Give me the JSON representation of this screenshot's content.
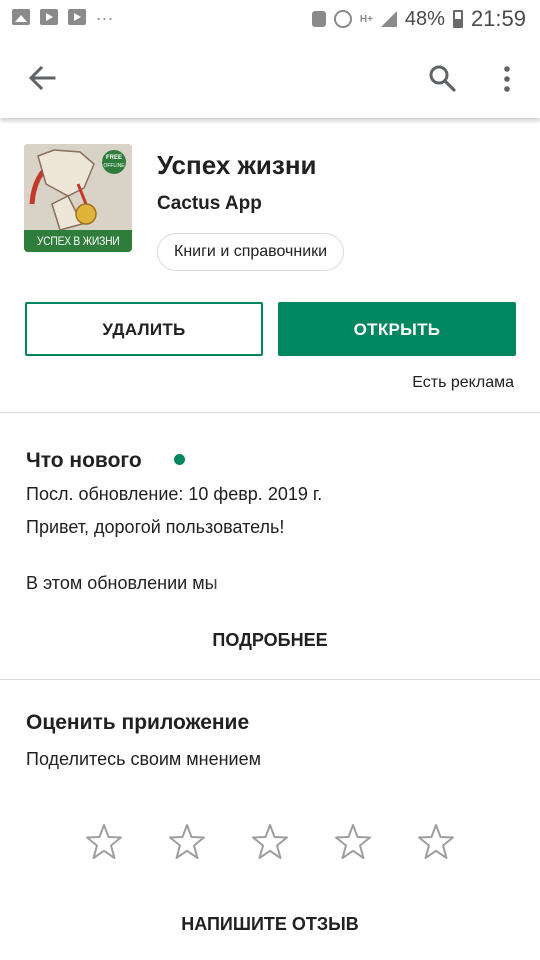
{
  "status_bar": {
    "battery": "48%",
    "time": "21:59",
    "network": "H+",
    "overflow": "...",
    "notification_icons": [
      "image-icon",
      "youtube-icon",
      "youtube-icon"
    ]
  },
  "app_bar": {
    "back_icon": "arrow-back-icon",
    "search_icon": "search-icon",
    "more_icon": "more-vert-icon"
  },
  "app": {
    "title": "Успех жизни",
    "developer": "Cactus App",
    "category": "Книги и справочники",
    "icon_banner": "УСПЕХ В ЖИЗНИ",
    "icon_badge_top": "FREE",
    "icon_badge_bottom": "OFFLINE"
  },
  "actions": {
    "remove_label": "УДАЛИТЬ",
    "open_label": "ОТКРЫТЬ",
    "ads_note": "Есть реклама"
  },
  "whats_new": {
    "title": "Что нового",
    "updated": "Посл. обновление: 10 февр. 2019 г.",
    "greeting": "Привет, дорогой пользователь!",
    "preview": "В этом обновлении мы",
    "more_label": "ПОДРОБНЕЕ"
  },
  "rate": {
    "title": "Оценить приложение",
    "subtitle": "Поделитесь своим мнением",
    "stars_total": 5,
    "stars_selected": 0,
    "write_review_label": "НАПИШИТЕ ОТЗЫВ"
  },
  "colors": {
    "accent": "#01875f",
    "text": "#212121",
    "divider": "#dcdcdc"
  }
}
